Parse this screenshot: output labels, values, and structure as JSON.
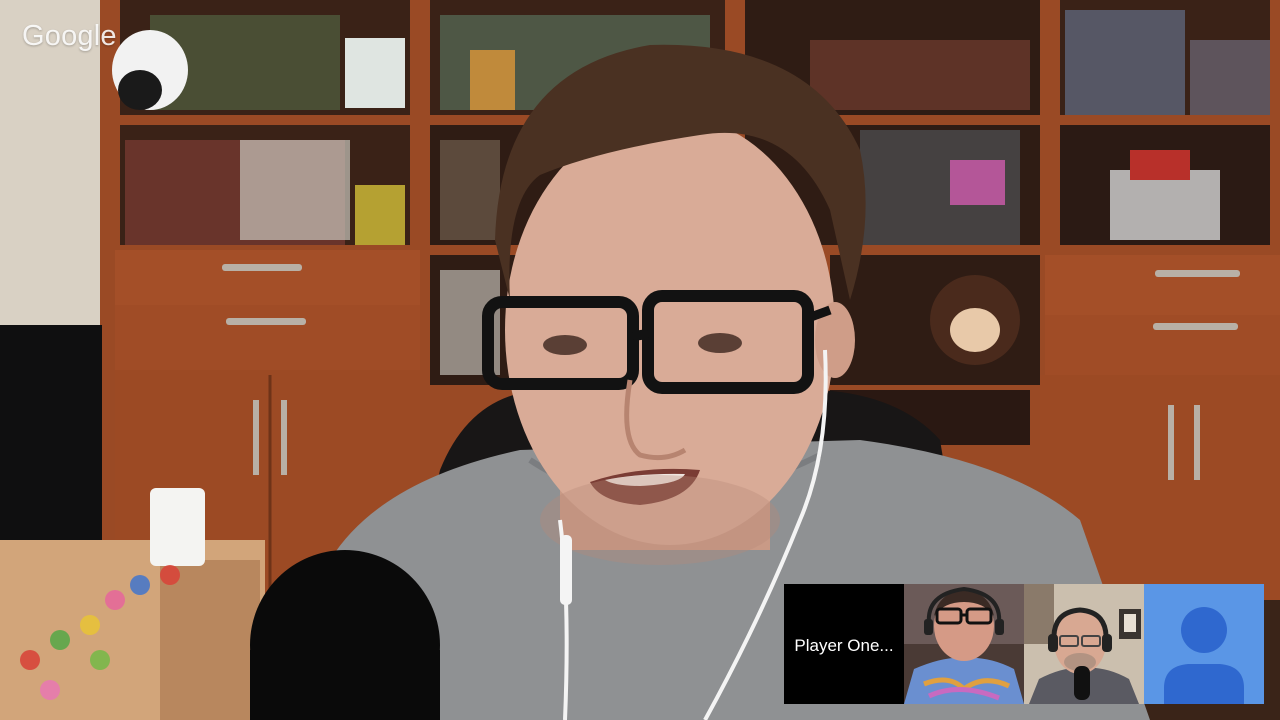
{
  "watermark": {
    "text": "Google"
  },
  "main_video": {
    "description_icon": "webcam-feed"
  },
  "participants": [
    {
      "label": "Player One...",
      "type": "name-tile"
    },
    {
      "label": "",
      "type": "video"
    },
    {
      "label": "",
      "type": "video"
    },
    {
      "label": "",
      "type": "default-avatar",
      "icon": "person-icon"
    }
  ],
  "colors": {
    "avatar_bg": "#5a96e6",
    "avatar_person": "#2f68cf",
    "name_tile_bg": "#000000"
  }
}
